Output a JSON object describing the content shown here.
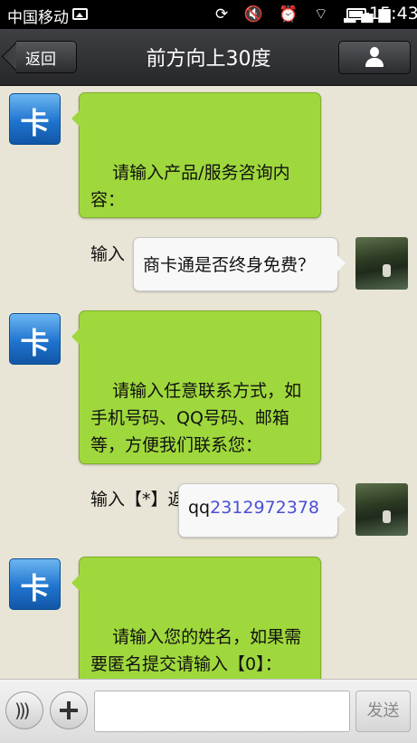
{
  "status_bar": {
    "carrier": "中国移动",
    "icons": "⟳ 🔇 ⏰ ⌔ ▂▄▆",
    "time": "15:43"
  },
  "header": {
    "back_label": "返回",
    "title": "前方向上30度",
    "profile_icon": "person-icon"
  },
  "messages": [
    {
      "from": "bot",
      "avatar_text": "卡",
      "text": "请输入产品/服务咨询内\n容：\n\n输入【*】返回主菜单！"
    },
    {
      "from": "user",
      "text": "商卡通是否终身免费？"
    },
    {
      "from": "bot",
      "avatar_text": "卡",
      "text": "请输入任意联系方式，如\n手机号码、QQ号码、邮箱\n等，方便我们联系您：\n\n输入【*】返回主菜单！"
    },
    {
      "from": "user",
      "text_prefix": "qq",
      "text_link": "2312972378"
    },
    {
      "from": "bot",
      "avatar_text": "卡",
      "text": "请输入您的姓名，如果需\n要匿名提交请输入【0】：\n\n输入【*】返回主菜单！"
    }
  ],
  "input_bar": {
    "voice_icon": "voice-icon",
    "add_icon": "plus-icon",
    "input_value": "",
    "input_placeholder": "",
    "send_label": "发送"
  },
  "colors": {
    "bot_bubble": "#9fd83c",
    "user_bubble": "#f8f8f8",
    "link": "#4a4fd6",
    "title_bar": "#2f3033"
  }
}
